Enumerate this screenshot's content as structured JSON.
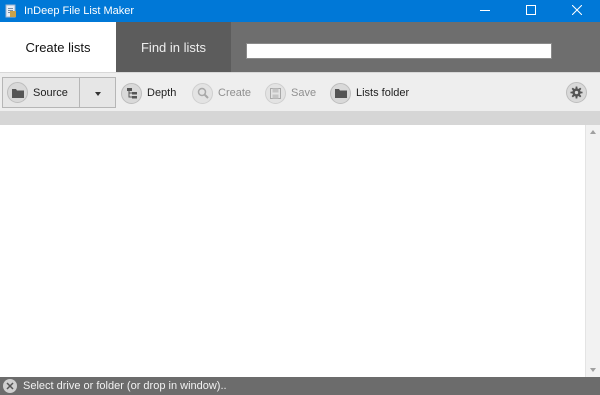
{
  "window": {
    "title": "InDeep File List Maker",
    "app_icon": "document-icon",
    "controls": [
      "minimize-icon",
      "maximize-icon",
      "close-icon"
    ]
  },
  "tabs": [
    {
      "label": "Create lists",
      "active": true
    },
    {
      "label": "Find in lists",
      "active": false
    }
  ],
  "search": {
    "value": "",
    "placeholder": ""
  },
  "toolbar": {
    "source_label": "Source",
    "source_icon": "folder-icon",
    "dropdown_icon": "caret-down-icon",
    "depth_label": "Depth",
    "depth_icon": "tree-icon",
    "create_label": "Create",
    "create_icon": "magnifier-icon",
    "save_label": "Save",
    "save_icon": "floppy-icon",
    "lists_folder_label": "Lists folder",
    "lists_folder_icon": "folder-icon",
    "settings_icon": "gear-icon"
  },
  "status": {
    "icon": "error-x-icon",
    "text": "Select drive or folder (or drop in window).."
  },
  "colors": {
    "titlebar": "#0078d7",
    "tabbar": "#6e6e6e",
    "toolbar": "#eeeeee",
    "statusbar": "#6c6c6c"
  }
}
